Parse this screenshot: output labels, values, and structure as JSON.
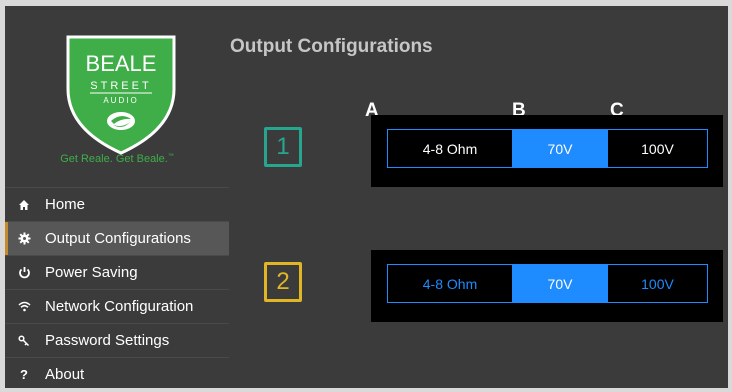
{
  "brand": {
    "logo_line1": "BEALE",
    "logo_line2": "STREET",
    "logo_line3": "AUDIO",
    "tagline": "Get Reale. Get Beale.",
    "tagline_mark": "™",
    "logo_color": "#3fae49"
  },
  "page": {
    "title": "Output Configurations"
  },
  "nav": {
    "items": [
      {
        "label": "Home",
        "icon": "home-icon",
        "glyph": "🏠"
      },
      {
        "label": "Output Configurations",
        "icon": "gear-icon",
        "glyph": "⚙",
        "active": true
      },
      {
        "label": "Power Saving",
        "icon": "power-icon",
        "glyph": "⏻"
      },
      {
        "label": "Network Configuration",
        "icon": "wifi-icon",
        "glyph": "≋"
      },
      {
        "label": "Password Settings",
        "icon": "key-icon",
        "glyph": "⚷"
      },
      {
        "label": "About",
        "icon": "question-icon",
        "glyph": "?"
      }
    ]
  },
  "columns": {
    "a": "A",
    "b": "B",
    "c": "C"
  },
  "zones": [
    {
      "number": "1",
      "color": "#27a68f",
      "options": [
        "4-8 Ohm",
        "70V",
        "100V"
      ],
      "selected": "70V"
    },
    {
      "number": "2",
      "color": "#e1b625",
      "options": [
        "4-8 Ohm",
        "70V",
        "100V"
      ],
      "selected": "70V"
    }
  ],
  "accent": "#1e8bff"
}
